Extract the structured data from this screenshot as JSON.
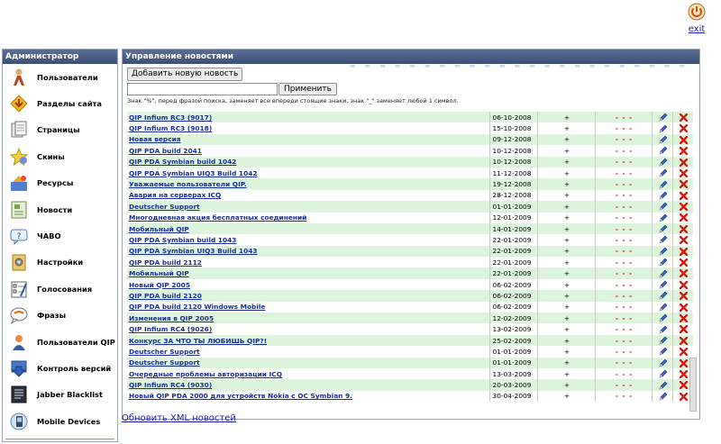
{
  "header": {
    "exit_label": "exit"
  },
  "sidebar": {
    "title": "Администратор",
    "items": [
      {
        "label": "Пользователи",
        "icon": "users-icon"
      },
      {
        "label": "Разделы сайта",
        "icon": "sections-icon"
      },
      {
        "label": "Страницы",
        "icon": "pages-icon"
      },
      {
        "label": "Скины",
        "icon": "skins-icon"
      },
      {
        "label": "Ресурсы",
        "icon": "resources-icon"
      },
      {
        "label": "Новости",
        "icon": "news-icon"
      },
      {
        "label": "ЧАВО",
        "icon": "faq-icon"
      },
      {
        "label": "Настройки",
        "icon": "settings-icon"
      },
      {
        "label": "Голосования",
        "icon": "polls-icon"
      },
      {
        "label": "Фразы",
        "icon": "phrases-icon"
      },
      {
        "label": "Пользователи QIP",
        "icon": "qip-users-icon"
      },
      {
        "label": "Контроль версий",
        "icon": "version-control-icon"
      },
      {
        "label": "Jabber Blacklist",
        "icon": "blacklist-icon"
      },
      {
        "label": "Mobile Devices",
        "icon": "mobile-devices-icon"
      }
    ]
  },
  "main": {
    "title": "Управление новостями",
    "add_button_label": "Добавить новую новость",
    "search": {
      "value": "",
      "placeholder": ""
    },
    "apply_button_label": "Применить",
    "hint": "Знак \"%\", перед фразой поиска, заменяет все впереди стоящие знаки, знак \"_\" заменяет любой 1 символ.",
    "rows": [
      {
        "title": "QIP Infium RC3 (9017)",
        "date": "06-10-2008",
        "published": "+",
        "status": "- - -"
      },
      {
        "title": "QIP Infium RC3 (9018)",
        "date": "15-10-2008",
        "published": "+",
        "status": "- - -"
      },
      {
        "title": "Новая версия",
        "date": "09-12-2008",
        "published": "+",
        "status": "- - -"
      },
      {
        "title": "QIP PDA build 2041",
        "date": "10-12-2008",
        "published": "+",
        "status": "- - -"
      },
      {
        "title": "QIP PDA Symbian build 1042",
        "date": "10-12-2008",
        "published": "+",
        "status": "- - -"
      },
      {
        "title": "QIP PDA Symbian UIQ3 Build 1042",
        "date": "11-12-2008",
        "published": "+",
        "status": "- - -"
      },
      {
        "title": "Уважаемые пользователи QIP.",
        "date": "19-12-2008",
        "published": "+",
        "status": "- - -"
      },
      {
        "title": "Авария на серверах ICQ",
        "date": "28-12-2008",
        "published": "+",
        "status": "- - -"
      },
      {
        "title": "Deutscher Support",
        "date": "01-01-2009",
        "published": "+",
        "status": "- - -"
      },
      {
        "title": "Многодневная акция бесплатных соединений",
        "date": "12-01-2009",
        "published": "+",
        "status": "- - -"
      },
      {
        "title": "Мобильный QIP",
        "date": "14-01-2009",
        "published": "+",
        "status": "- - -"
      },
      {
        "title": "QIP PDA Symbian build 1043",
        "date": "22-01-2009",
        "published": "+",
        "status": "- - -"
      },
      {
        "title": "QIP PDA Symbian UIQ3 Build 1043",
        "date": "22-01-2009",
        "published": "+",
        "status": "- - -"
      },
      {
        "title": "QIP PDA build 2112",
        "date": "22-01-2009",
        "published": "+",
        "status": "- - -"
      },
      {
        "title": "Мобильный QIP",
        "date": "22-01-2009",
        "published": "+",
        "status": "- - -"
      },
      {
        "title": "Новый QIP 2005",
        "date": "06-02-2009",
        "published": "+",
        "status": "- - -"
      },
      {
        "title": "QIP PDA build 2120",
        "date": "06-02-2009",
        "published": "+",
        "status": "- - -"
      },
      {
        "title": "QIP PDA build 2120 Windows Mobile",
        "date": "06-02-2009",
        "published": "+",
        "status": "- - -"
      },
      {
        "title": "Изменения в QIP 2005",
        "date": "12-02-2009",
        "published": "+",
        "status": "- - -"
      },
      {
        "title": "QIP Infium RC4 (9026)",
        "date": "13-02-2009",
        "published": "+",
        "status": "- - -"
      },
      {
        "title": "Конкурс ЗА ЧТО ТЫ ЛЮБИШЬ QIP?!",
        "date": "25-02-2009",
        "published": "+",
        "status": "- - -"
      },
      {
        "title": "Deutscher Support",
        "date": "01-01-2009",
        "published": "+",
        "status": "- - -"
      },
      {
        "title": "Deutscher Support",
        "date": "01-01-2009",
        "published": "+",
        "status": "- - -"
      },
      {
        "title": "Очередные проблемы авторизации ICQ",
        "date": "13-03-2009",
        "published": "+",
        "status": "- - -"
      },
      {
        "title": "QIP Infium RC4 (9030)",
        "date": "20-03-2009",
        "published": "+",
        "status": "- - -"
      },
      {
        "title": "Новый QIP PDA 2000 для устройств Nokia с ОС Symbian 9.",
        "date": "30-04-2009",
        "published": "+",
        "status": "- - -"
      }
    ]
  },
  "footer": {
    "xml_link_label": "Обновить XML новостей"
  },
  "colors": {
    "panel_header": "#4a5f86",
    "row_alt": "#ddf5dc",
    "link": "#1b2f9c",
    "status_red": "#c00000"
  }
}
